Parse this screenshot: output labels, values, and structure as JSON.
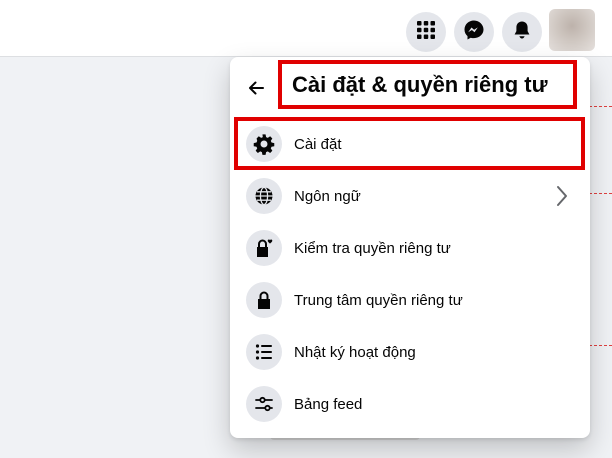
{
  "topbar": {
    "buttons": [
      {
        "name": "menu",
        "icon": "grid-icon"
      },
      {
        "name": "messenger",
        "icon": "messenger-icon"
      },
      {
        "name": "notifications",
        "icon": "bell-icon"
      }
    ],
    "avatar": "profile-avatar"
  },
  "menu": {
    "title": "Cài đặt & quyền riêng tư",
    "back_icon": "arrow-left-icon",
    "items": [
      {
        "label": "Cài đặt",
        "icon": "gear-icon",
        "highlighted": true
      },
      {
        "label": "Ngôn ngữ",
        "icon": "globe-icon",
        "has_submenu": true
      },
      {
        "label": "Kiểm tra quyền riêng tư",
        "icon": "lock-heart-icon"
      },
      {
        "label": "Trung tâm quyền riêng tư",
        "icon": "lock-icon"
      },
      {
        "label": "Nhật ký hoạt động",
        "icon": "list-icon"
      },
      {
        "label": "Bảng feed",
        "icon": "sliders-icon"
      }
    ]
  },
  "colors": {
    "highlight": "#e00000",
    "icon_bg": "#e4e6eb",
    "page_bg": "#f0f2f5",
    "text": "#050505"
  }
}
